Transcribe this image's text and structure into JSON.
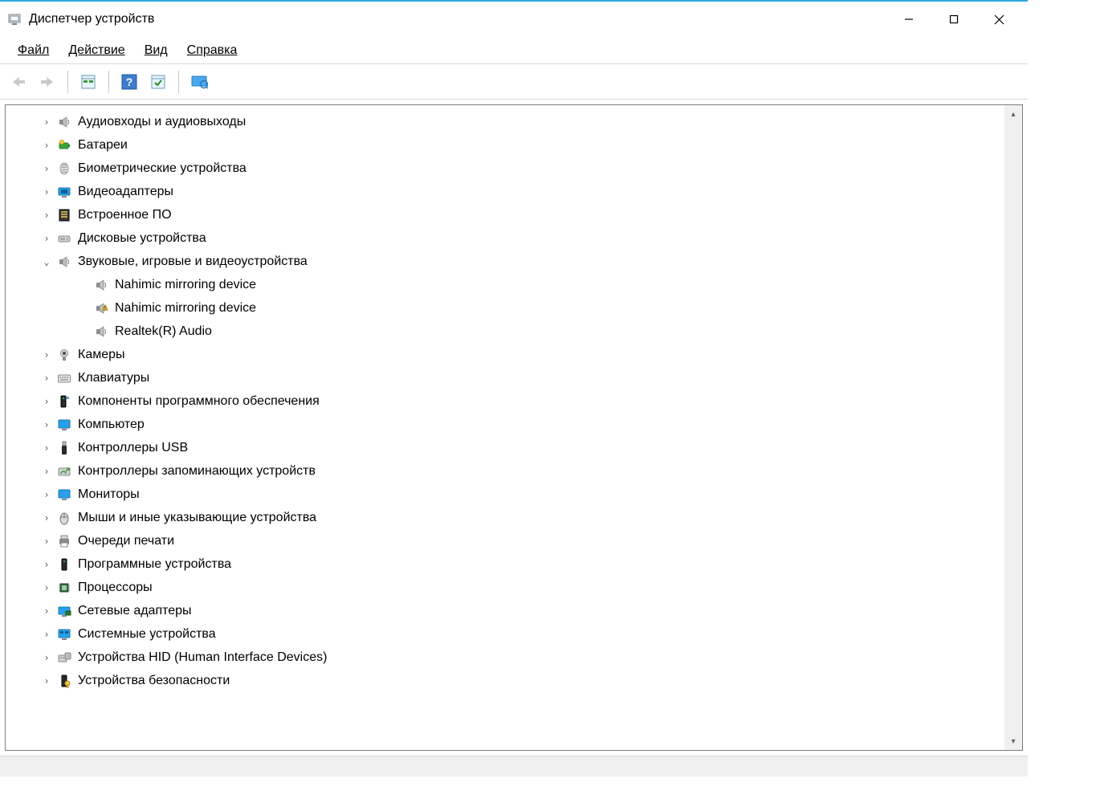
{
  "window": {
    "title": "Диспетчер устройств"
  },
  "menu": {
    "file": "Файл",
    "action": "Действие",
    "view": "Вид",
    "help": "Справка"
  },
  "tree": {
    "items": [
      {
        "label": "Аудиовходы и аудиовыходы",
        "icon": "speaker",
        "expanded": false
      },
      {
        "label": "Батареи",
        "icon": "battery",
        "expanded": false
      },
      {
        "label": "Биометрические устройства",
        "icon": "fingerprint",
        "expanded": false
      },
      {
        "label": "Видеоадаптеры",
        "icon": "display-adapter",
        "expanded": false
      },
      {
        "label": "Встроенное ПО",
        "icon": "firmware",
        "expanded": false
      },
      {
        "label": "Дисковые устройства",
        "icon": "disk",
        "expanded": false
      },
      {
        "label": "Звуковые, игровые и видеоустройства",
        "icon": "speaker",
        "expanded": true,
        "children": [
          {
            "label": "Nahimic mirroring device",
            "icon": "speaker",
            "warning": false
          },
          {
            "label": "Nahimic mirroring device",
            "icon": "speaker",
            "warning": true
          },
          {
            "label": "Realtek(R) Audio",
            "icon": "speaker",
            "warning": false
          }
        ]
      },
      {
        "label": "Камеры",
        "icon": "camera",
        "expanded": false
      },
      {
        "label": "Клавиатуры",
        "icon": "keyboard",
        "expanded": false
      },
      {
        "label": "Компоненты программного обеспечения",
        "icon": "software-component",
        "expanded": false
      },
      {
        "label": "Компьютер",
        "icon": "monitor",
        "expanded": false
      },
      {
        "label": "Контроллеры USB",
        "icon": "usb",
        "expanded": false
      },
      {
        "label": "Контроллеры запоминающих устройств",
        "icon": "storage-controller",
        "expanded": false
      },
      {
        "label": "Мониторы",
        "icon": "monitor",
        "expanded": false
      },
      {
        "label": "Мыши и иные указывающие устройства",
        "icon": "mouse",
        "expanded": false
      },
      {
        "label": "Очереди печати",
        "icon": "printer",
        "expanded": false
      },
      {
        "label": "Программные устройства",
        "icon": "software-device",
        "expanded": false
      },
      {
        "label": "Процессоры",
        "icon": "cpu",
        "expanded": false
      },
      {
        "label": "Сетевые адаптеры",
        "icon": "network",
        "expanded": false
      },
      {
        "label": "Системные устройства",
        "icon": "system",
        "expanded": false
      },
      {
        "label": "Устройства HID (Human Interface Devices)",
        "icon": "hid",
        "expanded": false
      },
      {
        "label": "Устройства безопасности",
        "icon": "security",
        "expanded": false
      }
    ]
  }
}
